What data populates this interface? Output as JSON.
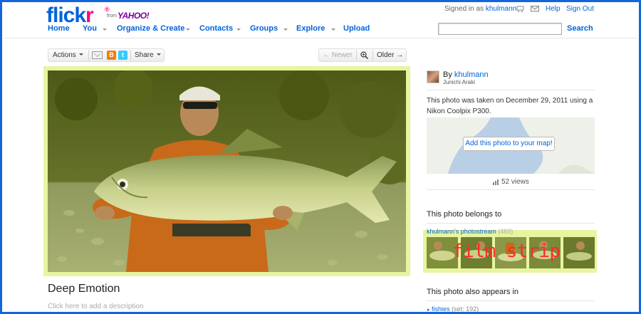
{
  "header": {
    "logo_f": "flickr",
    "logo_mark": "®",
    "from": "from",
    "yahoo": "YAHOO!",
    "signed_in_prefix": "Signed in as",
    "username": "khulmann",
    "help": "Help",
    "sign_out": "Sign Out",
    "search_button": "Search",
    "search_value": ""
  },
  "nav": {
    "home": "Home",
    "you": "You",
    "organize": "Organize & Create",
    "contacts": "Contacts",
    "groups": "Groups",
    "explore": "Explore",
    "upload": "Upload"
  },
  "toolbar": {
    "actions": "Actions",
    "blogger": "B",
    "twitter": "t",
    "share": "Share",
    "newer": "← Newer",
    "older": "Older →"
  },
  "photo": {
    "title": "Deep Emotion",
    "description_placeholder": "Click here to add a description",
    "highlight_color": "#e9f4a0"
  },
  "sidebar": {
    "by_prefix": "By",
    "owner": "khulmann",
    "real_name": "Junichi Araki",
    "taken_text": "This photo was taken on December 29, 2011 using a Nikon Coolpix P300.",
    "map_button": "Add this photo to your map!",
    "views": "52 views",
    "belongs_heading": "This photo belongs to",
    "stream_label": "khulmann's photostream",
    "stream_count": "(469)",
    "filmstrip_overlay": "film strip",
    "appears_heading": "This photo also appears in",
    "set_name": "fishies",
    "set_count": "(set: 192)"
  },
  "colors": {
    "link": "#0063dc",
    "brand_pink": "#ff0084",
    "overlay_text": "#ff2a2a",
    "frame": "#1166dd"
  }
}
